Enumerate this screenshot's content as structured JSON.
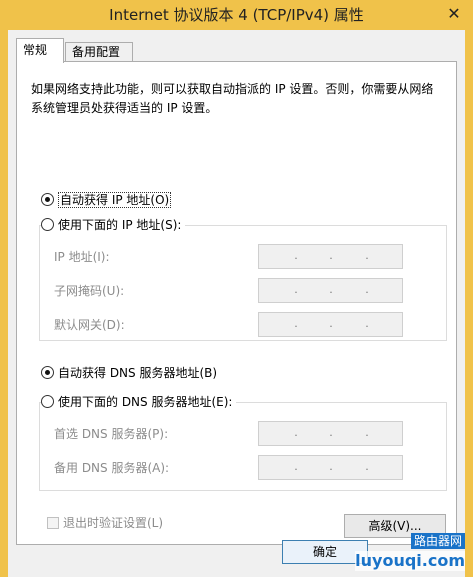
{
  "window": {
    "title": "Internet 协议版本 4 (TCP/IPv4) 属性",
    "close_glyph": "✕"
  },
  "tabs": [
    {
      "label": "常规",
      "active": true
    },
    {
      "label": "备用配置",
      "active": false
    }
  ],
  "intro_text": "如果网络支持此功能，则可以获取自动指派的 IP 设置。否则，你需要从网络系统管理员处获得适当的 IP 设置。",
  "ip_section": {
    "auto_label": "自动获得 IP 地址(O)",
    "auto_checked": true,
    "manual_label": "使用下面的 IP 地址(S):",
    "manual_checked": false,
    "fields": [
      {
        "label": "IP 地址(I):"
      },
      {
        "label": "子网掩码(U):"
      },
      {
        "label": "默认网关(D):"
      }
    ]
  },
  "dns_section": {
    "auto_label": "自动获得 DNS 服务器地址(B)",
    "auto_checked": true,
    "manual_label": "使用下面的 DNS 服务器地址(E):",
    "manual_checked": false,
    "fields": [
      {
        "label": "首选 DNS 服务器(P):"
      },
      {
        "label": "备用 DNS 服务器(A):"
      }
    ]
  },
  "validate_label": "退出时验证设置(L)",
  "advanced_button": "高级(V)...",
  "ok_button": "确定",
  "watermark": {
    "line1": "路由器网",
    "line2": "luyouqi.com"
  },
  "ip_dot": "."
}
